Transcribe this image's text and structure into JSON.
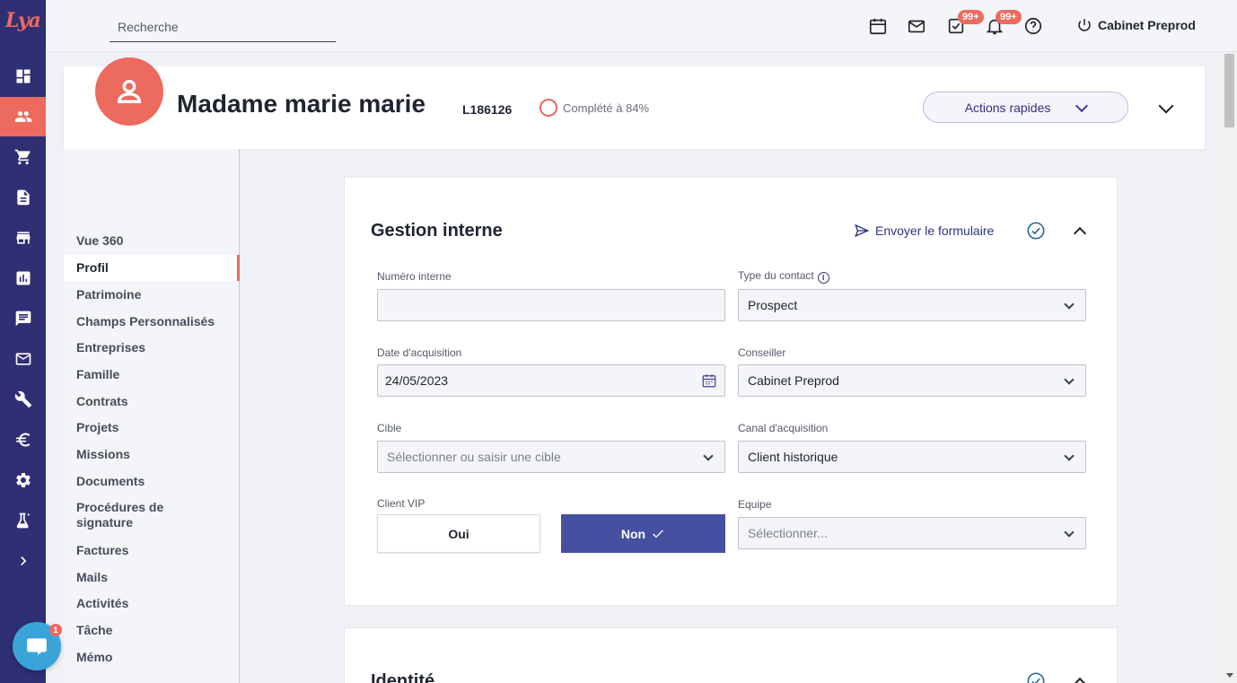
{
  "app": {
    "logo_text": "Lya"
  },
  "rail": {
    "items": [
      {
        "icon": "dashboard-icon"
      },
      {
        "icon": "contacts-icon",
        "active": true
      },
      {
        "icon": "cart-icon"
      },
      {
        "icon": "document-icon"
      },
      {
        "icon": "store-icon"
      },
      {
        "icon": "chart-icon"
      },
      {
        "icon": "chat-icon"
      },
      {
        "icon": "mail-icon"
      },
      {
        "icon": "tools-icon"
      },
      {
        "icon": "euro-icon"
      },
      {
        "icon": "gear-icon"
      },
      {
        "icon": "lab-icon"
      },
      {
        "icon": "expand-icon"
      }
    ]
  },
  "topbar": {
    "search_placeholder": "Recherche",
    "tasks_badge": "99+",
    "notifications_badge": "99+",
    "user_label": "Cabinet Preprod"
  },
  "header": {
    "client_name": "Madame marie marie",
    "client_code": "L186126",
    "completion": "Complété à 84%",
    "quick_actions": "Actions rapides"
  },
  "subnav": {
    "items": [
      "Vue 360",
      "Profil",
      "Patrimoine",
      "Champs Personnalisés",
      "Entreprises",
      "Famille",
      "Contrats",
      "Projets",
      "Missions",
      "Documents",
      "Procédures de signature",
      "Factures",
      "Mails",
      "Activités",
      "Tâche",
      "Mémo"
    ],
    "active_index": 1
  },
  "gestion": {
    "title": "Gestion interne",
    "send_form": "Envoyer le formulaire",
    "numero_interne_label": "Numéro interne",
    "numero_interne_value": "",
    "type_contact_label": "Type du contact",
    "type_contact_value": "Prospect",
    "date_acquisition_label": "Date d'acquisition",
    "date_acquisition_value": "24/05/2023",
    "conseiller_label": "Conseiller",
    "conseiller_value": "Cabinet Preprod",
    "cible_label": "Cible",
    "cible_placeholder": "Sélectionner ou saisir une cible",
    "canal_label": "Canal d'acquisition",
    "canal_value": "Client historique",
    "vip_label": "Client VIP",
    "vip_yes": "Oui",
    "vip_no": "Non",
    "vip_selected": "Non",
    "equipe_label": "Equipe",
    "equipe_placeholder": "Sélectionner..."
  },
  "identite": {
    "title": "Identité"
  },
  "chat": {
    "badge": "1"
  }
}
